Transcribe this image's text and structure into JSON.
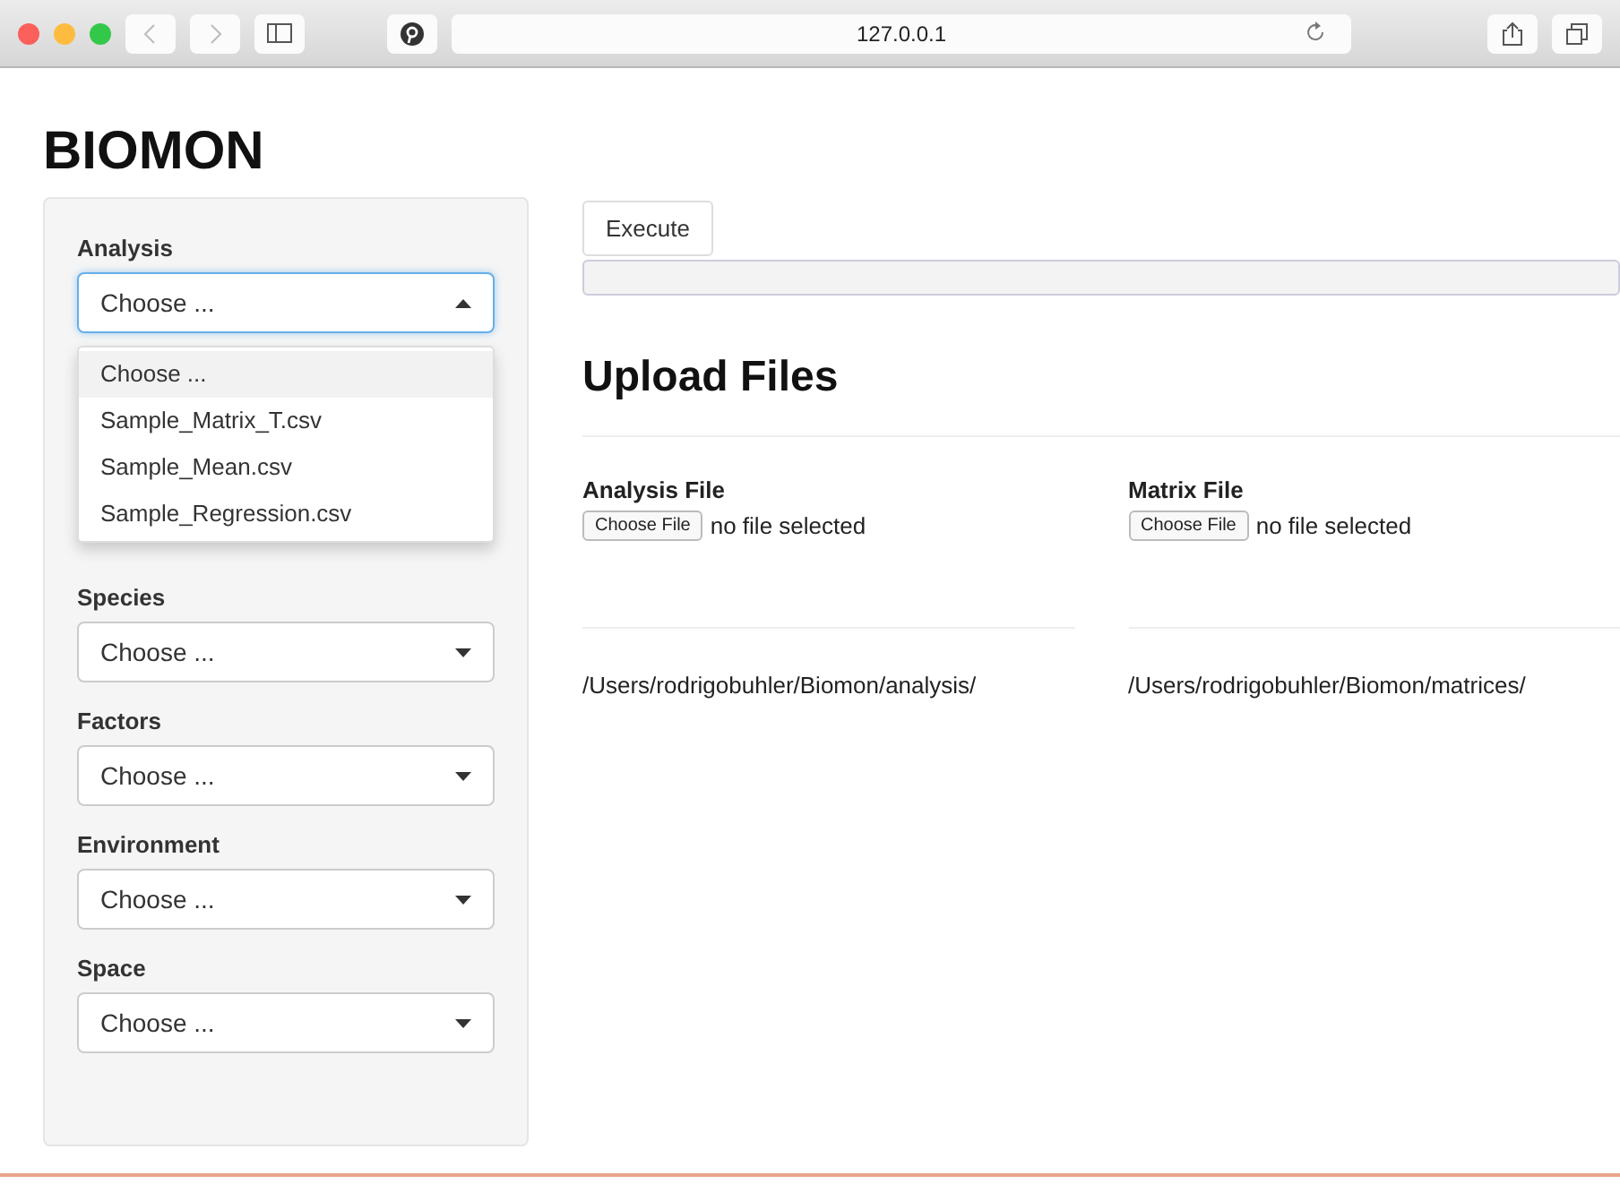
{
  "browser": {
    "url": "127.0.0.1"
  },
  "title": "BIOMON",
  "sidebar": {
    "selects": [
      {
        "label": "Analysis",
        "value": "Choose ...",
        "expanded": true,
        "options": [
          {
            "label": "Choose ...",
            "selected": true
          },
          {
            "label": "Sample_Matrix_T.csv",
            "selected": false
          },
          {
            "label": "Sample_Mean.csv",
            "selected": false
          },
          {
            "label": "Sample_Regression.csv",
            "selected": false
          }
        ]
      },
      {
        "label": "Species",
        "value": "Choose ...",
        "expanded": false
      },
      {
        "label": "Factors",
        "value": "Choose ...",
        "expanded": false
      },
      {
        "label": "Environment",
        "value": "Choose ...",
        "expanded": false
      },
      {
        "label": "Space",
        "value": "Choose ...",
        "expanded": false
      }
    ]
  },
  "main": {
    "execute_button": "Execute",
    "heading": "Upload Files",
    "uploads": [
      {
        "label": "Analysis File",
        "button": "Choose File",
        "status": "no file selected",
        "path": "/Users/rodrigobuhler/Biomon/analysis/"
      },
      {
        "label": "Matrix File",
        "button": "Choose File",
        "status": "no file selected",
        "path": "/Users/rodrigobuhler/Biomon/matrices/"
      }
    ]
  }
}
